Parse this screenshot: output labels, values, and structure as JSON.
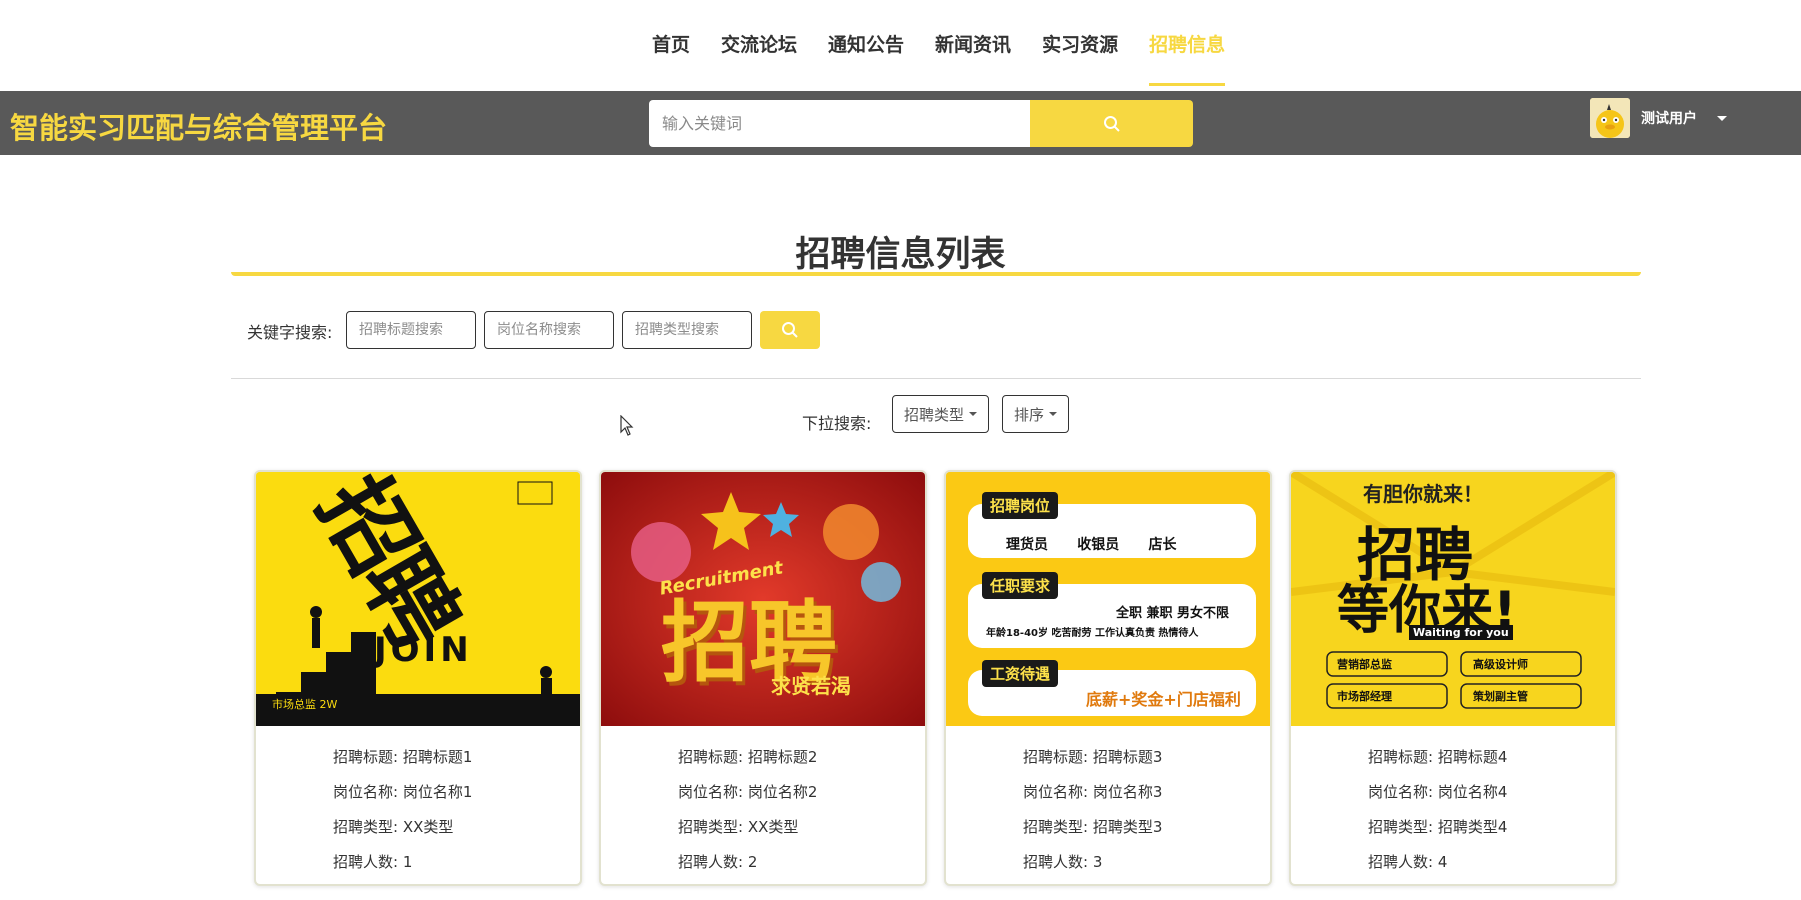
{
  "nav": {
    "items": [
      "首页",
      "交流论坛",
      "通知公告",
      "新闻资讯",
      "实习资源",
      "招聘信息"
    ],
    "active_index": 5
  },
  "header": {
    "title": "智能实习匹配与综合管理平台",
    "search_placeholder": "输入关键词",
    "username": "测试用户"
  },
  "page": {
    "title": "招聘信息列表",
    "keyword_search_label": "关键字搜索:",
    "keyword_placeholders": [
      "招聘标题搜索",
      "岗位名称搜索",
      "招聘类型搜索"
    ],
    "dropdown_label": "下拉搜索:",
    "dropdowns": [
      "招聘类型",
      "排序"
    ]
  },
  "card_labels": {
    "title": "招聘标题:",
    "position": "岗位名称:",
    "type": "招聘类型:",
    "count": "招聘人数:"
  },
  "cards": [
    {
      "title": "招聘标题1",
      "position": "岗位名称1",
      "type": "XX类型",
      "count": "1"
    },
    {
      "title": "招聘标题2",
      "position": "岗位名称2",
      "type": "XX类型",
      "count": "2"
    },
    {
      "title": "招聘标题3",
      "position": "岗位名称3",
      "type": "招聘类型3",
      "count": "3"
    },
    {
      "title": "招聘标题4",
      "position": "岗位名称4",
      "type": "招聘类型4",
      "count": "4"
    }
  ],
  "posters": {
    "p1": {
      "main": "招聘",
      "sub": "JOIN",
      "tag": "市场总监 2W"
    },
    "p2": {
      "script": "Recruitment",
      "main": "招聘",
      "sub": "求贤若渴"
    },
    "p3": {
      "h1": "招聘岗位",
      "roles": [
        "理货员",
        "收银员",
        "店长"
      ],
      "h2": "任职要求",
      "req1": "全职  兼职  男女不限",
      "req2": "年龄18-40岁 吃苦耐劳 工作认真负责 热情待人",
      "h3": "工资待遇",
      "pay": "底薪+奖金+门店福利"
    },
    "p4": {
      "top": "有胆你就来！",
      "main1": "招聘",
      "main2": "等你来!",
      "sub": "Waiting for you",
      "roles": [
        "营销部总监",
        "高级设计师",
        "市场部经理",
        "策划副主管"
      ]
    }
  },
  "colors": {
    "accent": "#f7d841",
    "header_bg": "#595959"
  }
}
